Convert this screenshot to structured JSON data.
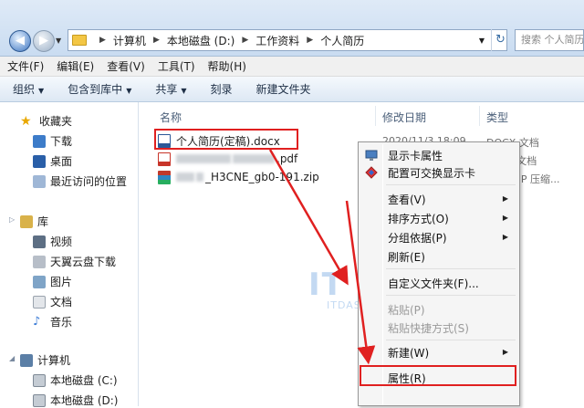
{
  "address": {
    "crumbs": [
      "计算机",
      "本地磁盘 (D:)",
      "工作资料",
      "个人简历"
    ],
    "search_placeholder": "搜索 个人简历"
  },
  "menu": [
    "文件(F)",
    "编辑(E)",
    "查看(V)",
    "工具(T)",
    "帮助(H)"
  ],
  "toolbar": {
    "organize": "组织",
    "include": "包含到库中",
    "share": "共享",
    "burn": "刻录",
    "new_folder": "新建文件夹"
  },
  "nav": {
    "favorites": "收藏夹",
    "downloads": "下载",
    "desktop": "桌面",
    "recent": "最近访问的位置",
    "libraries": "库",
    "videos": "视频",
    "cloud": "天翼云盘下载",
    "pictures": "图片",
    "documents": "文档",
    "music": "音乐",
    "computer": "计算机",
    "drive_c": "本地磁盘 (C:)",
    "drive_d": "本地磁盘 (D:)"
  },
  "columns": {
    "name": "名称",
    "date": "修改日期",
    "type": "类型"
  },
  "files": [
    {
      "name": "个人简历(定稿).docx",
      "date": "2020/11/3 18:09",
      "type": "DOCX 文档",
      "icon": "docx-icon"
    },
    {
      "name": ".pdf",
      "date": "",
      "type": "DF 文档",
      "icon": "pdf-icon"
    },
    {
      "name": "_H3CNE_gb0-191.zip",
      "date": "",
      "type": "R ZIP 压缩...",
      "icon": "zip-icon"
    }
  ],
  "context_menu": {
    "show_props": "显示卡属性",
    "config_switch": "配置可交换显示卡",
    "view": "查看(V)",
    "sort": "排序方式(O)",
    "group": "分组依据(P)",
    "refresh": "刷新(E)",
    "customize": "自定义文件夹(F)...",
    "paste": "粘贴(P)",
    "paste_shortcut": "粘贴快捷方式(S)",
    "new": "新建(W)",
    "properties": "属性(R)"
  },
  "watermark": {
    "logo": "IT",
    "url": "ITDAS"
  },
  "colors": {
    "highlight_red": "#e02020",
    "accent_blue": "#2b5797"
  }
}
